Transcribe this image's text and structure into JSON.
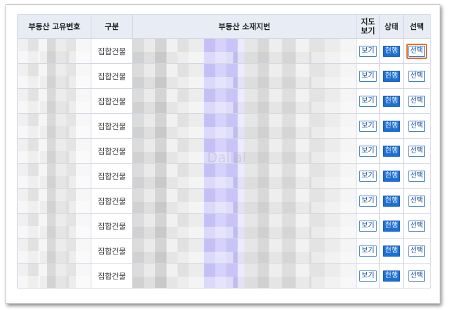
{
  "table": {
    "headers": {
      "id": "부동산 고유번호",
      "type": "구분",
      "address": "부동산 소재지번",
      "map_line1": "지도",
      "map_line2": "보기",
      "status": "상태",
      "select": "선택"
    },
    "rows": [
      {
        "type": "집합건물",
        "map": "보기",
        "status": "현행",
        "select": "선택",
        "highlighted": true
      },
      {
        "type": "집합건물",
        "map": "보기",
        "status": "현행",
        "select": "선택",
        "highlighted": false
      },
      {
        "type": "집합건물",
        "map": "보기",
        "status": "현행",
        "select": "선택",
        "highlighted": false
      },
      {
        "type": "집합건물",
        "map": "보기",
        "status": "현행",
        "select": "선택",
        "highlighted": false
      },
      {
        "type": "집합건물",
        "map": "보기",
        "status": "현행",
        "select": "선택",
        "highlighted": false
      },
      {
        "type": "집합건물",
        "map": "보기",
        "status": "현행",
        "select": "선택",
        "highlighted": false
      },
      {
        "type": "집합건물",
        "map": "보기",
        "status": "현행",
        "select": "선택",
        "highlighted": false
      },
      {
        "type": "집합건물",
        "map": "보기",
        "status": "현행",
        "select": "선택",
        "highlighted": false
      },
      {
        "type": "집합건물",
        "map": "보기",
        "status": "현행",
        "select": "선택",
        "highlighted": false
      },
      {
        "type": "집합건물",
        "map": "보기",
        "status": "현행",
        "select": "선택",
        "highlighted": false
      }
    ]
  },
  "watermark": "Dallal",
  "colors": {
    "header_bg": "#e8ecf5",
    "border": "#d2d8e3",
    "status_bg": "#1d6fd0",
    "highlight": "#ef6a2f"
  }
}
